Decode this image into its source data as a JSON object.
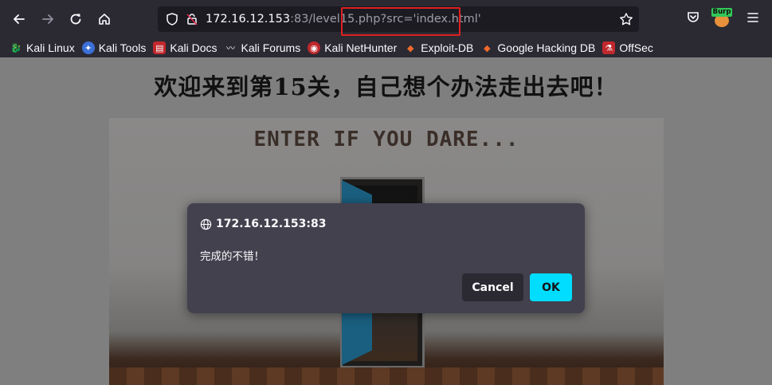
{
  "toolbar": {
    "url_host": "172.16.12.153",
    "url_rest": ":83/level15.php?src='index.html'",
    "burp_label": "Burp"
  },
  "bookmarks": [
    {
      "label": "Kali Linux",
      "icon": "kali-dragon-icon"
    },
    {
      "label": "Kali Tools",
      "icon": "kali-tools-icon"
    },
    {
      "label": "Kali Docs",
      "icon": "kali-docs-icon"
    },
    {
      "label": "Kali Forums",
      "icon": "kali-forums-icon"
    },
    {
      "label": "Kali NetHunter",
      "icon": "nethunter-icon"
    },
    {
      "label": "Exploit-DB",
      "icon": "exploit-db-icon"
    },
    {
      "label": "Google Hacking DB",
      "icon": "ghdb-icon"
    },
    {
      "label": "OffSec",
      "icon": "offsec-icon"
    }
  ],
  "page": {
    "title": "欢迎来到第15关，自己想个办法走出去吧！",
    "scene_text": "ENTER IF YOU DARE..."
  },
  "dialog": {
    "origin": "172.16.12.153:83",
    "message": "完成的不错！",
    "cancel_label": "Cancel",
    "ok_label": "OK"
  },
  "colors": {
    "toolbar_bg": "#2b2a33",
    "dialog_bg": "#42414d",
    "ok_button": "#00ddff",
    "highlight": "#e02020"
  }
}
